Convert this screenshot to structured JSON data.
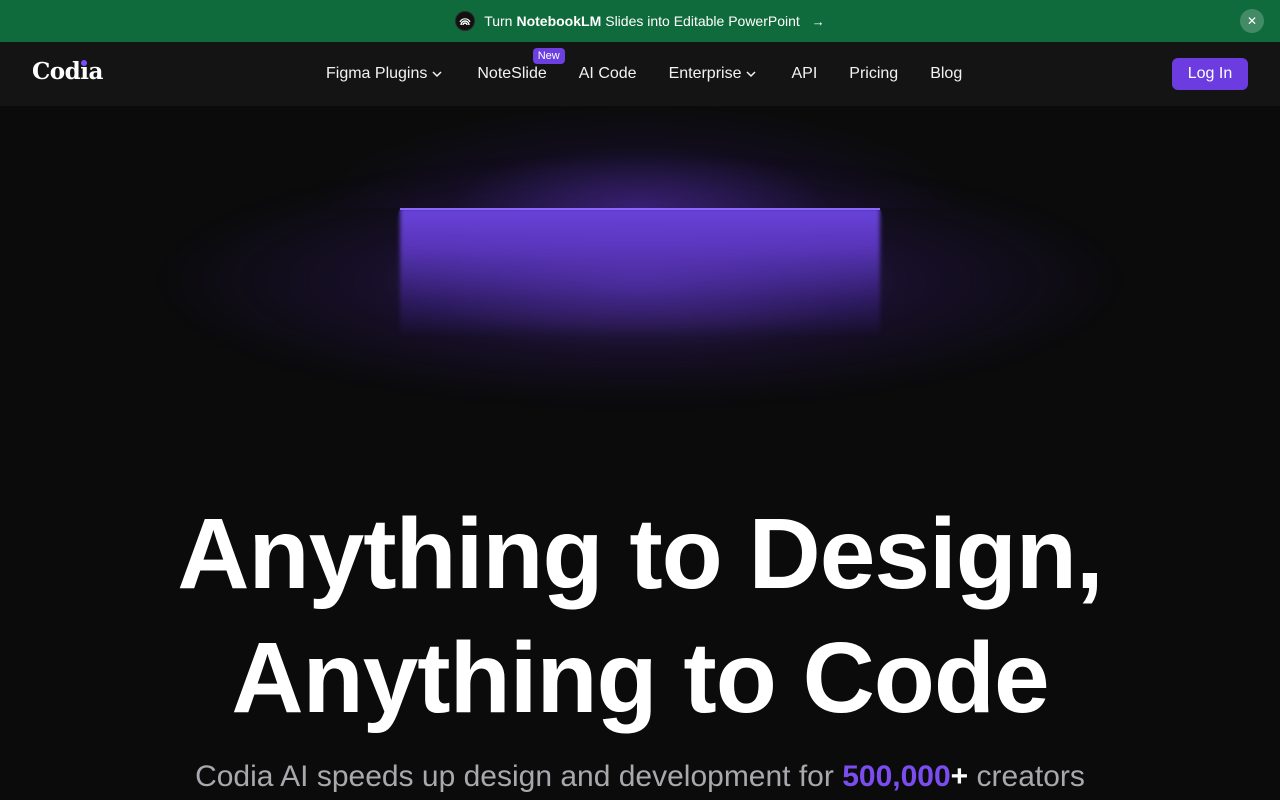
{
  "announcement": {
    "prefix": "Turn",
    "highlight": "NotebookLM",
    "suffix": "Slides into Editable PowerPoint",
    "arrow": "→",
    "close": "✕"
  },
  "nav": {
    "logo": {
      "part1": "Cod",
      "part2": "ia"
    },
    "items": [
      {
        "label": "Figma Plugins",
        "has_dropdown": true
      },
      {
        "label": "NoteSlide",
        "badge": "New"
      },
      {
        "label": "AI Code"
      },
      {
        "label": "Enterprise",
        "has_dropdown": true
      },
      {
        "label": "API"
      },
      {
        "label": "Pricing"
      },
      {
        "label": "Blog"
      }
    ],
    "login": "Log In"
  },
  "hero": {
    "title_line1": "Anything to Design,",
    "title_line2": "Anything to Code",
    "subtitle_prefix": "Codia AI speeds up design and development for",
    "subtitle_count": "500,000",
    "subtitle_plus": "+",
    "subtitle_suffix": "creators"
  },
  "colors": {
    "banner_bg": "#0f6b3c",
    "accent": "#6c3ce1",
    "page_bg": "#0b0b0c"
  }
}
